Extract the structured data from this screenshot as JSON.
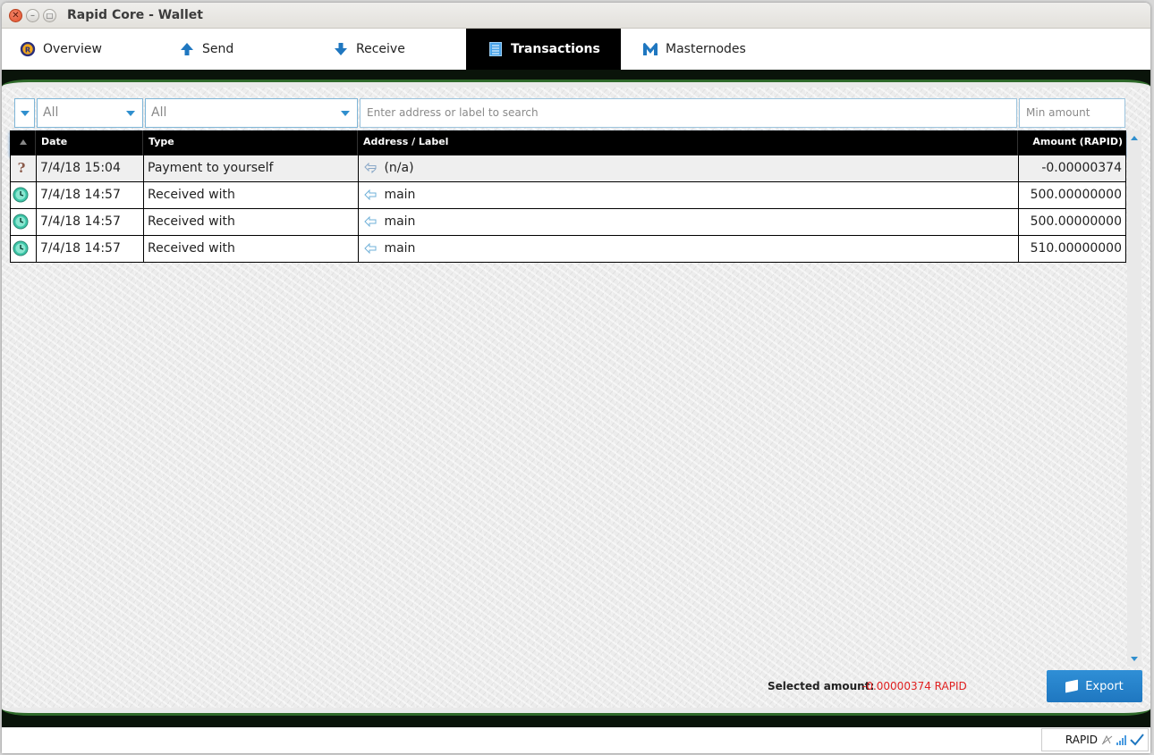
{
  "window": {
    "title": "Rapid Core - Wallet"
  },
  "tabs": [
    {
      "label": "Overview",
      "icon": "rapid-logo-icon"
    },
    {
      "label": "Send",
      "icon": "arrow-up-icon"
    },
    {
      "label": "Receive",
      "icon": "arrow-down-icon"
    },
    {
      "label": "Transactions",
      "icon": "transactions-list-icon",
      "active": true
    },
    {
      "label": "Masternodes",
      "icon": "masternode-icon"
    }
  ],
  "filters": {
    "date": "All",
    "type": "All",
    "search_placeholder": "Enter address or label to search",
    "min_amount_placeholder": "Min amount"
  },
  "table": {
    "columns": [
      "Date",
      "Type",
      "Address / Label",
      "Amount (RAPID)"
    ],
    "rows": [
      {
        "status_icon": "question-icon",
        "date": "7/4/18 15:04",
        "type": "Payment to yourself",
        "address_icon": "payment-to-self-icon",
        "address": "(n/a)",
        "amount": "-0.00000374"
      },
      {
        "status_icon": "clock-icon",
        "date": "7/4/18 14:57",
        "type": "Received with",
        "address_icon": "receive-arrow-icon",
        "address": "main",
        "amount": "500.00000000"
      },
      {
        "status_icon": "clock-icon",
        "date": "7/4/18 14:57",
        "type": "Received with",
        "address_icon": "receive-arrow-icon",
        "address": "main",
        "amount": "500.00000000"
      },
      {
        "status_icon": "clock-icon",
        "date": "7/4/18 14:57",
        "type": "Received with",
        "address_icon": "receive-arrow-icon",
        "address": "main",
        "amount": "510.00000000"
      }
    ]
  },
  "footer": {
    "selected_label": "Selected amount:",
    "selected_value": "-0.00000374 RAPID",
    "export_label": "Export"
  },
  "statusbar": {
    "unit": "RAPID"
  },
  "colors": {
    "accent": "#2f8fce",
    "negative": "#e02020",
    "header_bg": "#000000",
    "band_green": "#2f6a2a"
  }
}
